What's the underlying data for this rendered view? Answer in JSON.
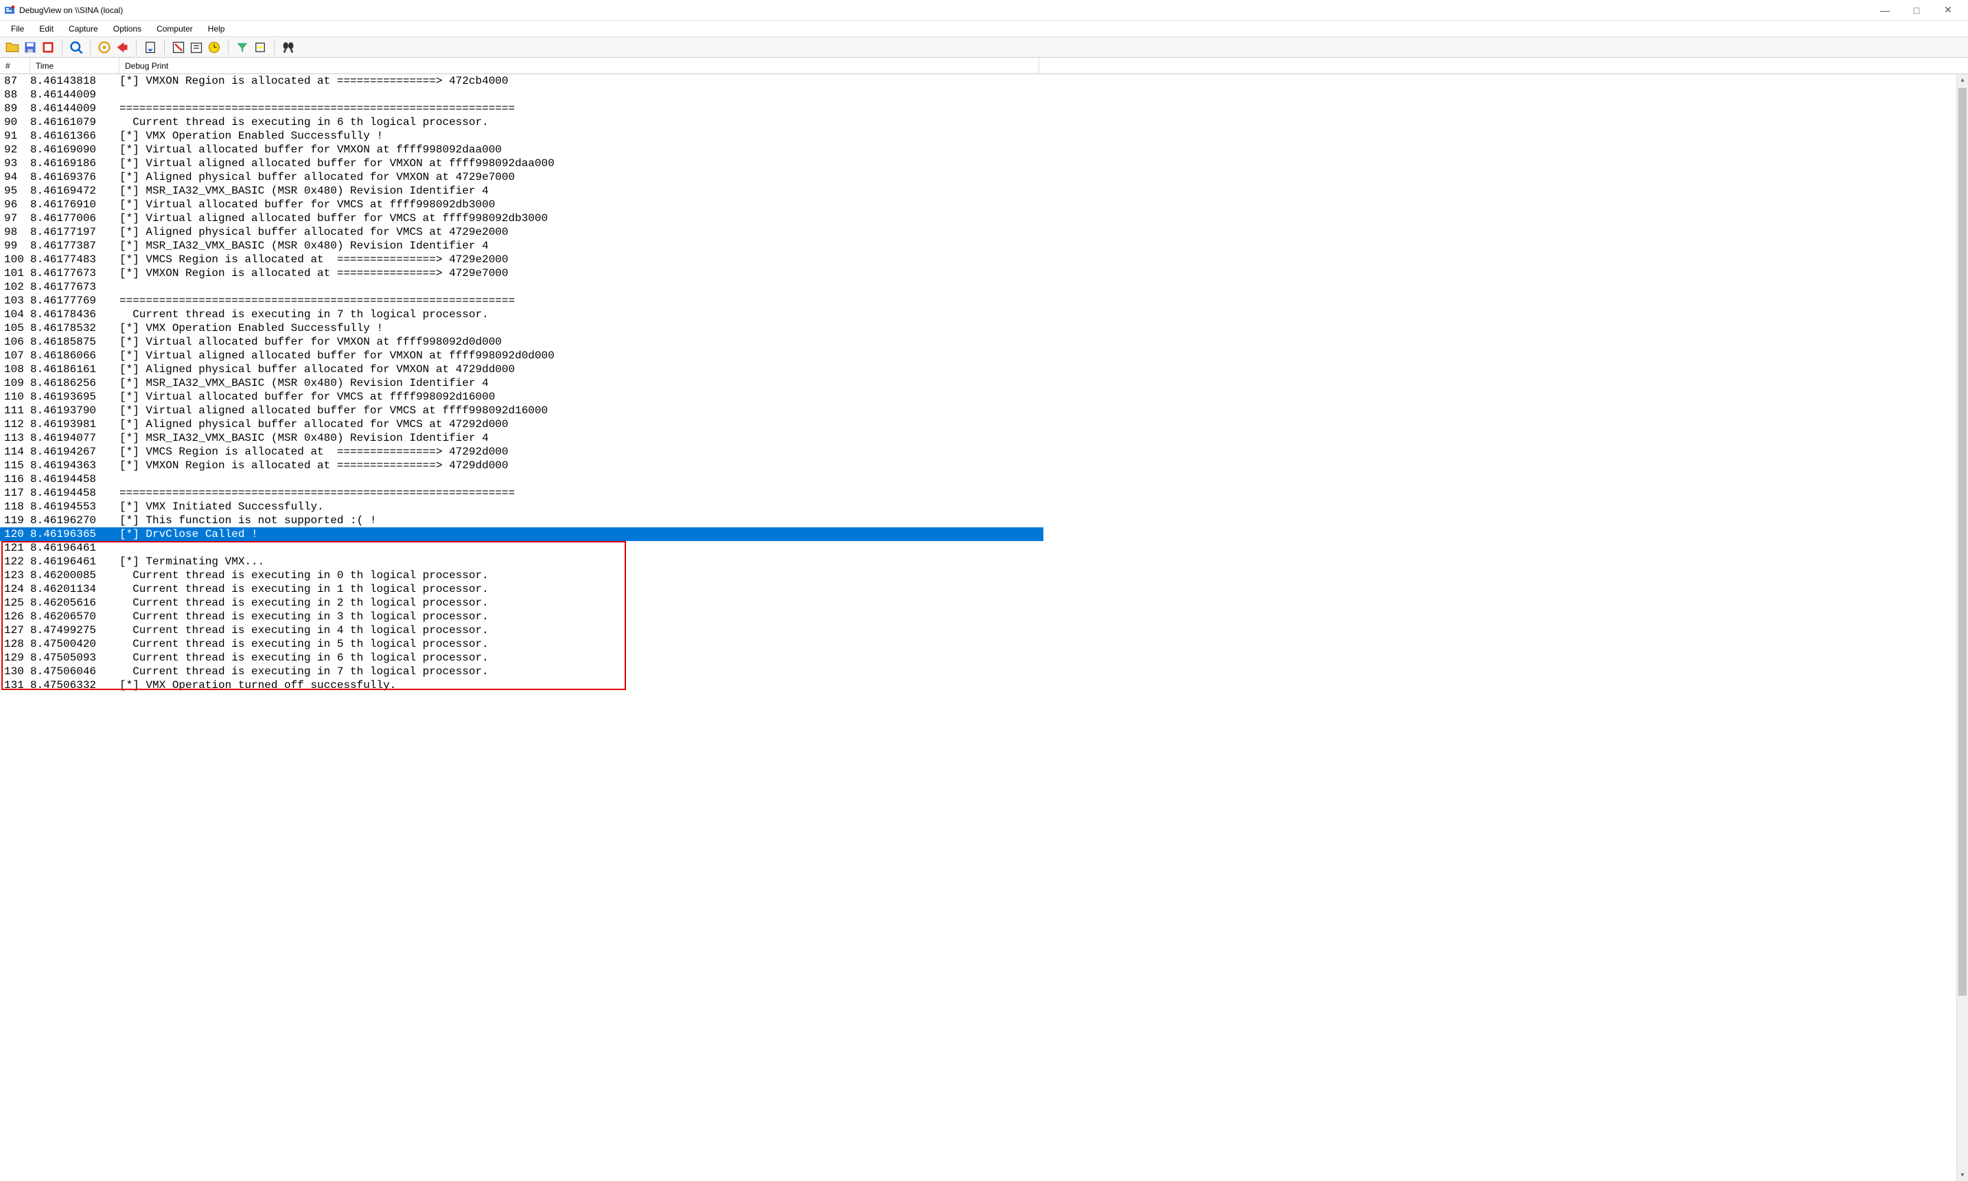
{
  "window": {
    "title": "DebugView on \\\\SINA (local)"
  },
  "menu": [
    "File",
    "Edit",
    "Capture",
    "Options",
    "Computer",
    "Help"
  ],
  "headers": {
    "num": "#",
    "time": "Time",
    "print": "Debug Print"
  },
  "selectedIndex": 33,
  "redBoxStart": 34,
  "redBoxEnd": 44,
  "rows": [
    {
      "n": "87",
      "t": "8.46143818",
      "p": "[*] VMXON Region is allocated at ===============> 472cb4000"
    },
    {
      "n": "88",
      "t": "8.46144009",
      "p": ""
    },
    {
      "n": "89",
      "t": "8.46144009",
      "p": "============================================================"
    },
    {
      "n": "90",
      "t": "8.46161079",
      "p": "  Current thread is executing in 6 th logical processor."
    },
    {
      "n": "91",
      "t": "8.46161366",
      "p": "[*] VMX Operation Enabled Successfully !"
    },
    {
      "n": "92",
      "t": "8.46169090",
      "p": "[*] Virtual allocated buffer for VMXON at ffff998092daa000"
    },
    {
      "n": "93",
      "t": "8.46169186",
      "p": "[*] Virtual aligned allocated buffer for VMXON at ffff998092daa000"
    },
    {
      "n": "94",
      "t": "8.46169376",
      "p": "[*] Aligned physical buffer allocated for VMXON at 4729e7000"
    },
    {
      "n": "95",
      "t": "8.46169472",
      "p": "[*] MSR_IA32_VMX_BASIC (MSR 0x480) Revision Identifier 4"
    },
    {
      "n": "96",
      "t": "8.46176910",
      "p": "[*] Virtual allocated buffer for VMCS at ffff998092db3000"
    },
    {
      "n": "97",
      "t": "8.46177006",
      "p": "[*] Virtual aligned allocated buffer for VMCS at ffff998092db3000"
    },
    {
      "n": "98",
      "t": "8.46177197",
      "p": "[*] Aligned physical buffer allocated for VMCS at 4729e2000"
    },
    {
      "n": "99",
      "t": "8.46177387",
      "p": "[*] MSR_IA32_VMX_BASIC (MSR 0x480) Revision Identifier 4"
    },
    {
      "n": "100",
      "t": "8.46177483",
      "p": "[*] VMCS Region is allocated at  ===============> 4729e2000"
    },
    {
      "n": "101",
      "t": "8.46177673",
      "p": "[*] VMXON Region is allocated at ===============> 4729e7000"
    },
    {
      "n": "102",
      "t": "8.46177673",
      "p": ""
    },
    {
      "n": "103",
      "t": "8.46177769",
      "p": "============================================================"
    },
    {
      "n": "104",
      "t": "8.46178436",
      "p": "  Current thread is executing in 7 th logical processor."
    },
    {
      "n": "105",
      "t": "8.46178532",
      "p": "[*] VMX Operation Enabled Successfully !"
    },
    {
      "n": "106",
      "t": "8.46185875",
      "p": "[*] Virtual allocated buffer for VMXON at ffff998092d0d000"
    },
    {
      "n": "107",
      "t": "8.46186066",
      "p": "[*] Virtual aligned allocated buffer for VMXON at ffff998092d0d000"
    },
    {
      "n": "108",
      "t": "8.46186161",
      "p": "[*] Aligned physical buffer allocated for VMXON at 4729dd000"
    },
    {
      "n": "109",
      "t": "8.46186256",
      "p": "[*] MSR_IA32_VMX_BASIC (MSR 0x480) Revision Identifier 4"
    },
    {
      "n": "110",
      "t": "8.46193695",
      "p": "[*] Virtual allocated buffer for VMCS at ffff998092d16000"
    },
    {
      "n": "111",
      "t": "8.46193790",
      "p": "[*] Virtual aligned allocated buffer for VMCS at ffff998092d16000"
    },
    {
      "n": "112",
      "t": "8.46193981",
      "p": "[*] Aligned physical buffer allocated for VMCS at 47292d000"
    },
    {
      "n": "113",
      "t": "8.46194077",
      "p": "[*] MSR_IA32_VMX_BASIC (MSR 0x480) Revision Identifier 4"
    },
    {
      "n": "114",
      "t": "8.46194267",
      "p": "[*] VMCS Region is allocated at  ===============> 47292d000"
    },
    {
      "n": "115",
      "t": "8.46194363",
      "p": "[*] VMXON Region is allocated at ===============> 4729dd000"
    },
    {
      "n": "116",
      "t": "8.46194458",
      "p": ""
    },
    {
      "n": "117",
      "t": "8.46194458",
      "p": "============================================================"
    },
    {
      "n": "118",
      "t": "8.46194553",
      "p": "[*] VMX Initiated Successfully."
    },
    {
      "n": "119",
      "t": "8.46196270",
      "p": "[*] This function is not supported :( !"
    },
    {
      "n": "120",
      "t": "8.46196365",
      "p": "[*] DrvClose Called !"
    },
    {
      "n": "121",
      "t": "8.46196461",
      "p": ""
    },
    {
      "n": "122",
      "t": "8.46196461",
      "p": "[*] Terminating VMX..."
    },
    {
      "n": "123",
      "t": "8.46200085",
      "p": "  Current thread is executing in 0 th logical processor."
    },
    {
      "n": "124",
      "t": "8.46201134",
      "p": "  Current thread is executing in 1 th logical processor."
    },
    {
      "n": "125",
      "t": "8.46205616",
      "p": "  Current thread is executing in 2 th logical processor."
    },
    {
      "n": "126",
      "t": "8.46206570",
      "p": "  Current thread is executing in 3 th logical processor."
    },
    {
      "n": "127",
      "t": "8.47499275",
      "p": "  Current thread is executing in 4 th logical processor."
    },
    {
      "n": "128",
      "t": "8.47500420",
      "p": "  Current thread is executing in 5 th logical processor."
    },
    {
      "n": "129",
      "t": "8.47505093",
      "p": "  Current thread is executing in 6 th logical processor."
    },
    {
      "n": "130",
      "t": "8.47506046",
      "p": "  Current thread is executing in 7 th logical processor."
    },
    {
      "n": "131",
      "t": "8.47506332",
      "p": "[*] VMX Operation turned off successfully."
    }
  ]
}
